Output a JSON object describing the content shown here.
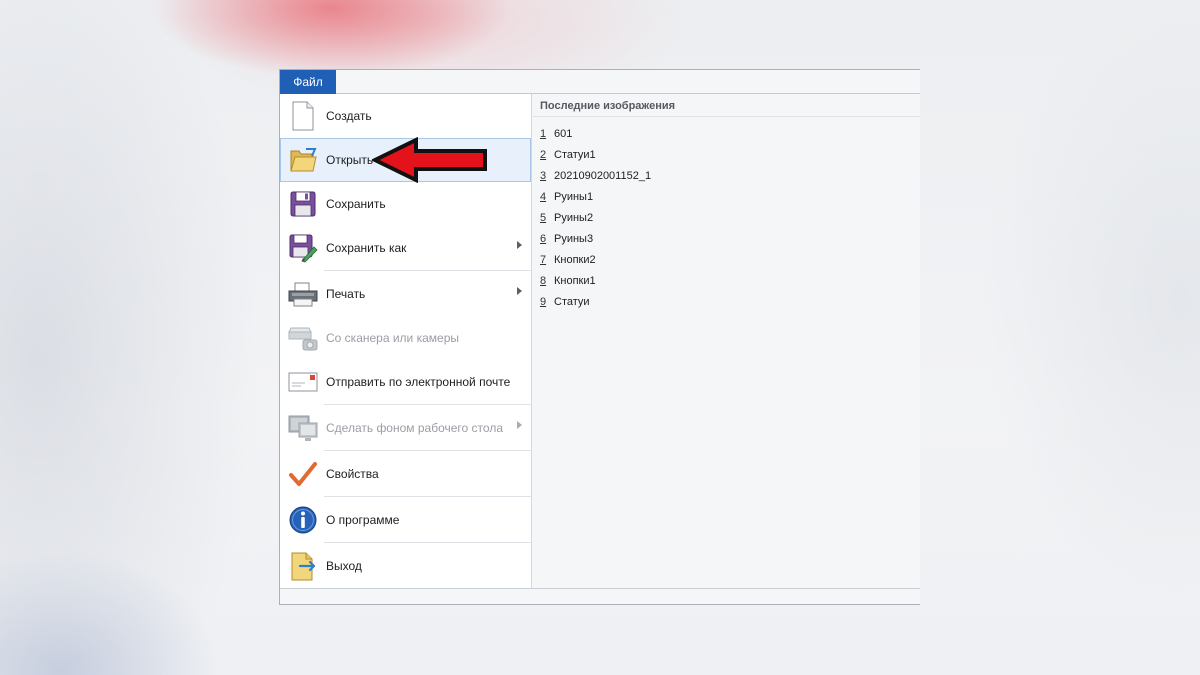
{
  "file_tab": {
    "label": "Файл"
  },
  "menu": {
    "items": [
      {
        "name": "create",
        "label": "Создать",
        "icon": "new-document-icon",
        "disabled": false,
        "submenu": false
      },
      {
        "name": "open",
        "label": "Открыть",
        "icon": "open-folder-icon",
        "disabled": false,
        "submenu": false,
        "highlighted": true
      },
      {
        "name": "save",
        "label": "Сохранить",
        "icon": "floppy-disk-icon",
        "disabled": false,
        "submenu": false
      },
      {
        "name": "save-as",
        "label": "Сохранить как",
        "icon": "save-as-icon",
        "disabled": false,
        "submenu": true
      },
      {
        "name": "print",
        "label": "Печать",
        "icon": "printer-icon",
        "disabled": false,
        "submenu": true
      },
      {
        "name": "scanner",
        "label": "Со сканера или камеры",
        "icon": "scanner-camera-icon",
        "disabled": true,
        "submenu": false
      },
      {
        "name": "email",
        "label": "Отправить по электронной почте",
        "icon": "envelope-icon",
        "disabled": false,
        "submenu": false
      },
      {
        "name": "wallpaper",
        "label": "Сделать фоном рабочего стола",
        "icon": "desktop-monitor-icon",
        "disabled": true,
        "submenu": true
      },
      {
        "name": "properties",
        "label": "Свойства",
        "icon": "checkmark-icon",
        "disabled": false,
        "submenu": false
      },
      {
        "name": "about",
        "label": "О программе",
        "icon": "info-icon",
        "disabled": false,
        "submenu": false
      },
      {
        "name": "exit",
        "label": "Выход",
        "icon": "exit-document-icon",
        "disabled": false,
        "submenu": false
      }
    ]
  },
  "recent": {
    "title": "Последние изображения",
    "items": [
      {
        "num": "1",
        "name": "601"
      },
      {
        "num": "2",
        "name": "Статуи1"
      },
      {
        "num": "3",
        "name": "20210902001152_1"
      },
      {
        "num": "4",
        "name": "Руины1"
      },
      {
        "num": "5",
        "name": "Руины2"
      },
      {
        "num": "6",
        "name": "Руины3"
      },
      {
        "num": "7",
        "name": "Кнопки2"
      },
      {
        "num": "8",
        "name": "Кнопки1"
      },
      {
        "num": "9",
        "name": "Статуи"
      }
    ]
  },
  "colors": {
    "file_tab": "#1f5fb5",
    "hover_bg": "#e8f1fb",
    "annotation_arrow": "#e3121b"
  }
}
